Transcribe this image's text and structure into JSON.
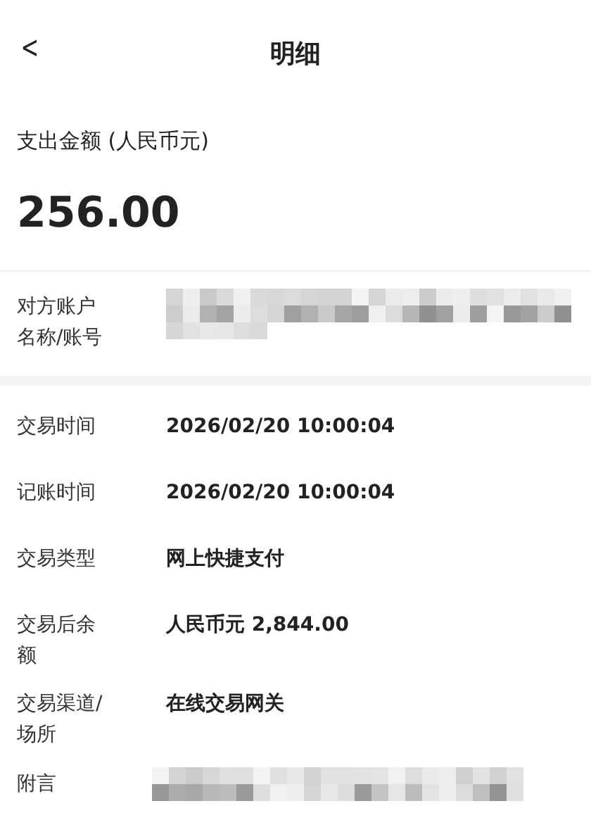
{
  "header": {
    "back": "<",
    "title": "明细"
  },
  "amount": {
    "label": "支出金额 (人民币元)",
    "value": "256.00"
  },
  "counterparty": {
    "label": "对方账户名称/账号",
    "kind": "redacted"
  },
  "details": [
    {
      "label": "交易时间",
      "kind": "text",
      "value": "2026/02/20 10:00:04"
    },
    {
      "label": "记账时间",
      "kind": "text",
      "value": "2026/02/20 10:00:04"
    },
    {
      "label": "交易类型",
      "kind": "text",
      "value": "网上快捷支付"
    },
    {
      "label": "交易后余额",
      "kind": "text",
      "value": "人民币元 2,844.00"
    },
    {
      "label": "交易渠道/场所",
      "kind": "text",
      "value": "在线交易网关"
    },
    {
      "label": "附言",
      "kind": "redacted"
    }
  ]
}
